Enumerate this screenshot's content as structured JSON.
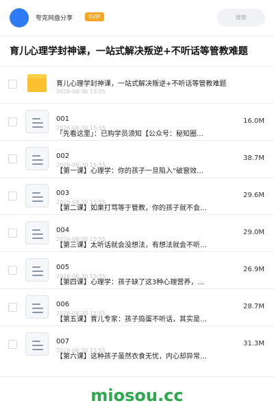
{
  "header": {
    "app_name": "夸克网盘分享",
    "badge": "SVIP",
    "search_placeholder": "搜索"
  },
  "page_title": "育儿心理学封神课，一站式解决叛逆+不听话等管教难题",
  "folder": {
    "name": "育儿心理学封神课，一站式解决叛逆+不听话等管教难题",
    "date": "2026-08-30 15:55"
  },
  "files": [
    {
      "name": "001",
      "date": "2026-08-30 15:55",
      "desc": "「先看这里」：已购学员须知【公众号：秘知圈…",
      "size": "16.0M"
    },
    {
      "name": "002",
      "date": "2026-08-30 15:55",
      "desc": "【第一课】心理学：你的孩子一旦陷入“破窗效…",
      "size": "38.7M"
    },
    {
      "name": "003",
      "date": "2026-08-30 15:55",
      "desc": "【第二课】如果打骂等于管教，你的孩子就不会…",
      "size": "29.6M"
    },
    {
      "name": "004",
      "date": "2026-08-30 15:55",
      "desc": "【第三课】太听话就会没想法，有想法就会不听…",
      "size": "29.0M"
    },
    {
      "name": "005",
      "date": "2026-08-30 15:55",
      "desc": "【第四课】心理学：孩子缺了这3种心理营养，…",
      "size": "26.9M"
    },
    {
      "name": "006",
      "date": "2026-08-30 15:55",
      "desc": "【第五课】育儿专家：孩子捣蛋不听话，其实是…",
      "size": "28.7M"
    },
    {
      "name": "007",
      "date": "2026-08-30 15:55",
      "desc": "【第六课】这种孩子虽然衣食无忧，内心却异常…",
      "size": "31.3M"
    }
  ],
  "watermark": "miosou.cc",
  "colors": {
    "accent": "#2f7bf5",
    "badge": "#f5a623",
    "folder": "#fbc02d",
    "watermark": "#2aa84a"
  }
}
